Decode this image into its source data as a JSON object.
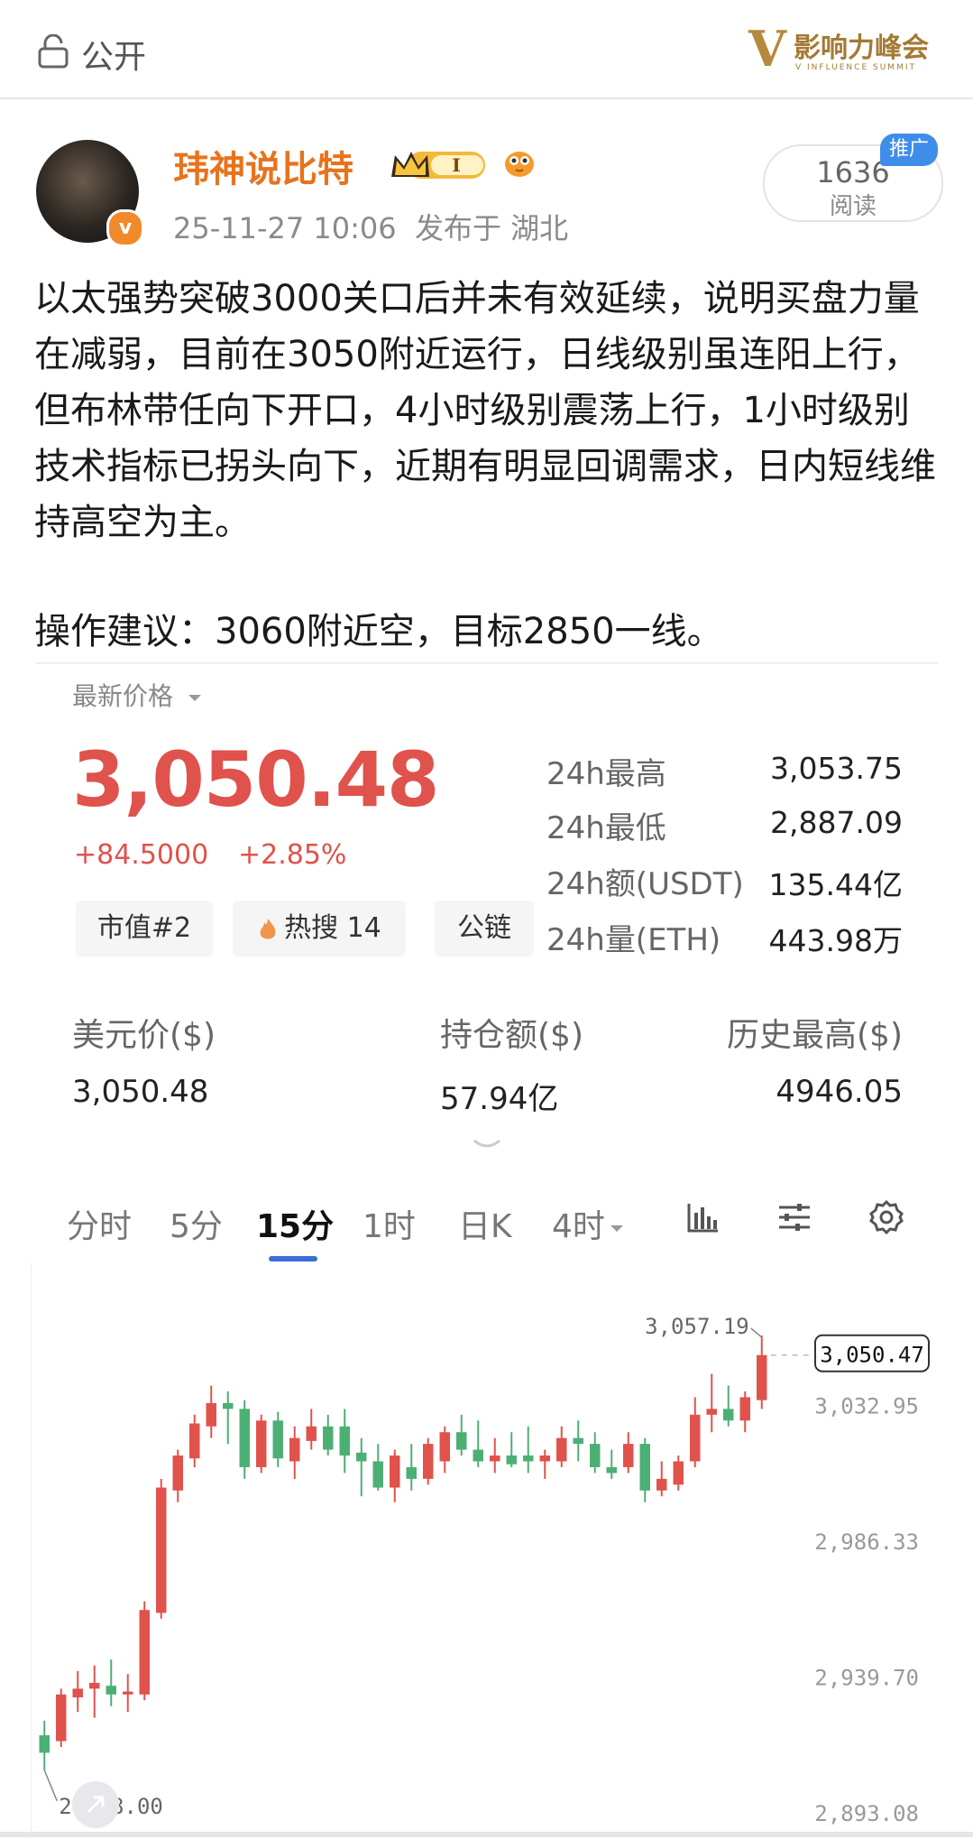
{
  "topbar": {
    "visibility": "公开",
    "logo_brand": "影响力峰会",
    "logo_sub": "V INFLUENCE SUMMIT"
  },
  "author": {
    "name": "玮神说比特",
    "badge_level": "I",
    "time": "25-11-27 10:06",
    "location": "发布于 湖北"
  },
  "reads": {
    "count": "1636",
    "label": "阅读",
    "promo": "推广"
  },
  "post": {
    "body": "以太强势突破3000关口后并未有效延续，说明买盘力量在减弱，目前在3050附近运行，日线级别虽连阳上行，但布林带任向下开口，4小时级别震荡上行，1小时级别技术指标已拐头向下，近期有明显回调需求，日内短线维持高空为主。",
    "advice": "操作建议：3060附近空，目标2850一线。"
  },
  "ticker": {
    "latest_label": "最新价格",
    "price": "3,050.48",
    "change_abs": "+84.5000",
    "change_pct": "+2.85%",
    "tags": [
      "市值#2",
      "热搜 14",
      "公链"
    ],
    "stats": [
      {
        "label": "24h最高",
        "value": "3,053.75"
      },
      {
        "label": "24h最低",
        "value": "2,887.09"
      },
      {
        "label": "24h额(USDT)",
        "value": "135.44亿"
      },
      {
        "label": "24h量(ETH)",
        "value": "443.98万"
      }
    ],
    "grid": [
      {
        "label": "美元价($)",
        "value": "3,050.48"
      },
      {
        "label": "持仓额($)",
        "value": "57.94亿"
      },
      {
        "label": "历史最高($)",
        "value": "4946.05"
      }
    ]
  },
  "timeframes": [
    "分时",
    "5分",
    "15分",
    "1时",
    "日K",
    "4时"
  ],
  "active_timeframe": "15分",
  "accent_up": "#e0524c",
  "accent_down": "#4caf74",
  "chart_data": {
    "type": "candlestick",
    "y_ticks": [
      "3,032.95",
      "2,986.33",
      "2,939.70",
      "2,893.08"
    ],
    "current_price_label": "3,050.47",
    "high_label": "3,057.19",
    "low_label": "2,908.00",
    "ylim": [
      2893.08,
      3057.19
    ],
    "candles": [
      {
        "o": 2920,
        "h": 2925,
        "l": 2908,
        "c": 2914
      },
      {
        "o": 2918,
        "h": 2936,
        "l": 2916,
        "c": 2934
      },
      {
        "o": 2933,
        "h": 2942,
        "l": 2928,
        "c": 2936
      },
      {
        "o": 2936,
        "h": 2944,
        "l": 2926,
        "c": 2938
      },
      {
        "o": 2937,
        "h": 2946,
        "l": 2930,
        "c": 2934
      },
      {
        "o": 2934,
        "h": 2941,
        "l": 2928,
        "c": 2935
      },
      {
        "o": 2934,
        "h": 2966,
        "l": 2932,
        "c": 2963
      },
      {
        "o": 2962,
        "h": 3008,
        "l": 2960,
        "c": 3005
      },
      {
        "o": 3004,
        "h": 3018,
        "l": 3000,
        "c": 3016
      },
      {
        "o": 3015,
        "h": 3030,
        "l": 3012,
        "c": 3027
      },
      {
        "o": 3026,
        "h": 3040,
        "l": 3022,
        "c": 3034
      },
      {
        "o": 3034,
        "h": 3038,
        "l": 3020,
        "c": 3032
      },
      {
        "o": 3032,
        "h": 3035,
        "l": 3008,
        "c": 3012
      },
      {
        "o": 3012,
        "h": 3030,
        "l": 3010,
        "c": 3028
      },
      {
        "o": 3028,
        "h": 3031,
        "l": 3012,
        "c": 3015
      },
      {
        "o": 3014,
        "h": 3026,
        "l": 3008,
        "c": 3022
      },
      {
        "o": 3021,
        "h": 3032,
        "l": 3018,
        "c": 3026
      },
      {
        "o": 3026,
        "h": 3030,
        "l": 3016,
        "c": 3018
      },
      {
        "o": 3026,
        "h": 3032,
        "l": 3010,
        "c": 3016
      },
      {
        "o": 3017,
        "h": 3022,
        "l": 3002,
        "c": 3014
      },
      {
        "o": 3014,
        "h": 3020,
        "l": 3004,
        "c": 3005
      },
      {
        "o": 3005,
        "h": 3018,
        "l": 3000,
        "c": 3016
      },
      {
        "o": 3012,
        "h": 3020,
        "l": 3004,
        "c": 3008
      },
      {
        "o": 3008,
        "h": 3022,
        "l": 3006,
        "c": 3020
      },
      {
        "o": 3014,
        "h": 3026,
        "l": 3010,
        "c": 3024
      },
      {
        "o": 3024,
        "h": 3030,
        "l": 3016,
        "c": 3018
      },
      {
        "o": 3018,
        "h": 3028,
        "l": 3012,
        "c": 3014
      },
      {
        "o": 3014,
        "h": 3022,
        "l": 3010,
        "c": 3016
      },
      {
        "o": 3016,
        "h": 3024,
        "l": 3012,
        "c": 3013
      },
      {
        "o": 3016,
        "h": 3026,
        "l": 3010,
        "c": 3014
      },
      {
        "o": 3014,
        "h": 3018,
        "l": 3008,
        "c": 3016
      },
      {
        "o": 3014,
        "h": 3026,
        "l": 3012,
        "c": 3022
      },
      {
        "o": 3022,
        "h": 3028,
        "l": 3014,
        "c": 3020
      },
      {
        "o": 3020,
        "h": 3024,
        "l": 3010,
        "c": 3012
      },
      {
        "o": 3012,
        "h": 3018,
        "l": 3008,
        "c": 3010
      },
      {
        "o": 3012,
        "h": 3024,
        "l": 3010,
        "c": 3020
      },
      {
        "o": 3020,
        "h": 3022,
        "l": 3000,
        "c": 3004
      },
      {
        "o": 3004,
        "h": 3014,
        "l": 3002,
        "c": 3008
      },
      {
        "o": 3006,
        "h": 3016,
        "l": 3004,
        "c": 3014
      },
      {
        "o": 3014,
        "h": 3036,
        "l": 3012,
        "c": 3030
      },
      {
        "o": 3030,
        "h": 3044,
        "l": 3024,
        "c": 3032
      },
      {
        "o": 3032,
        "h": 3040,
        "l": 3026,
        "c": 3028
      },
      {
        "o": 3028,
        "h": 3038,
        "l": 3024,
        "c": 3036
      },
      {
        "o": 3035,
        "h": 3057.19,
        "l": 3032,
        "c": 3050.47
      }
    ]
  }
}
